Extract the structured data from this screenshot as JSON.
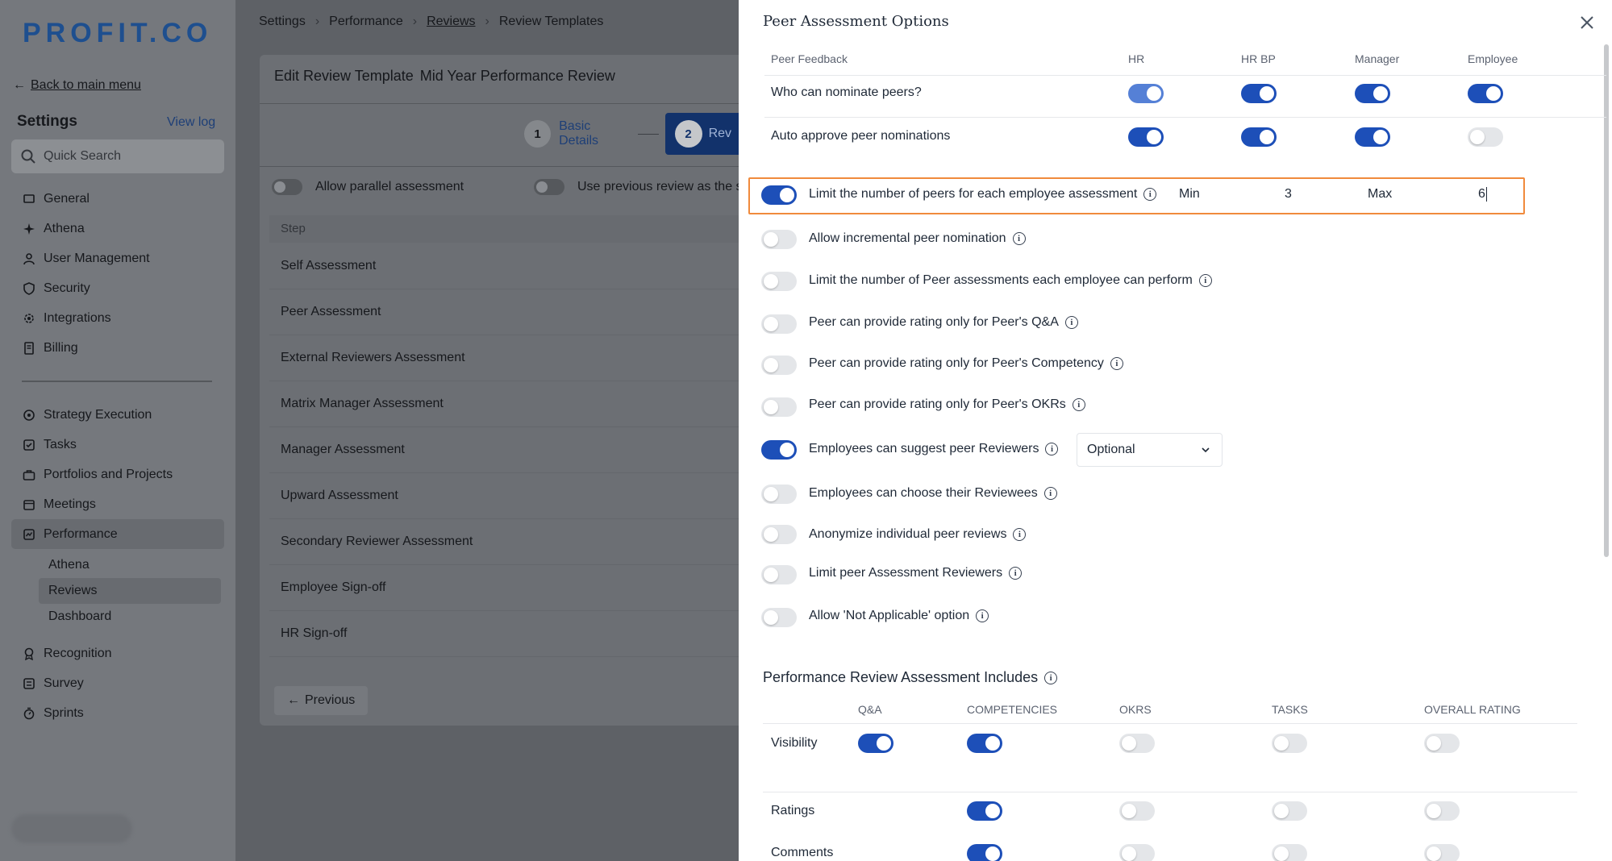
{
  "sidebar": {
    "logo": "PROFIT.CO",
    "back": "Back to main menu",
    "title": "Settings",
    "view_log": "View log",
    "search_placeholder": "Quick Search",
    "nav_a": [
      "General",
      "Athena",
      "User Management",
      "Security",
      "Integrations",
      "Billing"
    ],
    "nav_b": [
      "Strategy Execution",
      "Tasks",
      "Portfolios and Projects",
      "Meetings",
      "Performance"
    ],
    "sub_nav": [
      "Athena",
      "Reviews",
      "Dashboard"
    ],
    "nav_c": [
      "Recognition",
      "Survey",
      "Sprints"
    ]
  },
  "main": {
    "breadcrumb": [
      "Settings",
      "Performance",
      "Reviews",
      "Review Templates"
    ],
    "card_title": "Edit Review Template",
    "template_name": "Mid Year Performance Review",
    "steps": [
      {
        "num": "1",
        "label": "Basic Details"
      },
      {
        "num": "2",
        "label": "Rev"
      }
    ],
    "opt_parallel": "Allow parallel assessment",
    "opt_previous": "Use previous review as the s",
    "table_header": "Step",
    "step_rows": [
      "Self Assessment",
      "Peer Assessment",
      "External Reviewers Assessment",
      "Matrix Manager Assessment",
      "Manager Assessment",
      "Upward Assessment",
      "Secondary Reviewer Assessment",
      "Employee Sign-off",
      "HR Sign-off"
    ],
    "previous": "Previous"
  },
  "panel": {
    "title": "Peer Assessment Options",
    "peer_feedback": {
      "headers": [
        "Peer Feedback",
        "HR",
        "HR BP",
        "Manager",
        "Employee"
      ],
      "rows": [
        {
          "label": "Who can nominate peers?",
          "values": [
            true,
            true,
            true,
            true
          ]
        },
        {
          "label": "Auto approve peer nominations",
          "values": [
            true,
            true,
            true,
            false
          ]
        }
      ]
    },
    "limit": {
      "label": "Limit the number of peers for each employee assessment",
      "on": true,
      "min_label": "Min",
      "min_value": "3",
      "max_label": "Max",
      "max_value": "6"
    },
    "options": [
      {
        "label": "Allow incremental peer nomination",
        "on": false
      },
      {
        "label": "Limit the number of Peer assessments each employee can perform",
        "on": false
      },
      {
        "label": "Peer can provide rating only for Peer's Q&A",
        "on": false
      },
      {
        "label": "Peer can provide rating only for Peer's Competency",
        "on": false
      },
      {
        "label": "Peer can provide rating only for Peer's OKRs",
        "on": false
      },
      {
        "label": "Employees can suggest peer Reviewers",
        "on": true
      },
      {
        "label": "Employees can choose their Reviewees",
        "on": false
      },
      {
        "label": "Anonymize individual peer reviews",
        "on": false
      },
      {
        "label": "Limit peer Assessment Reviewers",
        "on": false
      },
      {
        "label": "Allow 'Not Applicable' option",
        "on": false
      }
    ],
    "suggest_select_value": "Optional",
    "includes": {
      "title": "Performance Review Assessment Includes",
      "columns": [
        "Q&A",
        "COMPETENCIES",
        "OKRS",
        "TASKS",
        "OVERALL RATING"
      ],
      "rows": [
        {
          "label": "Visibility",
          "values": [
            true,
            true,
            false,
            false,
            false
          ]
        },
        {
          "label": "Ratings",
          "values": [
            null,
            true,
            false,
            false,
            false
          ]
        },
        {
          "label": "Comments",
          "values": [
            null,
            true,
            false,
            false,
            false
          ]
        }
      ]
    }
  }
}
